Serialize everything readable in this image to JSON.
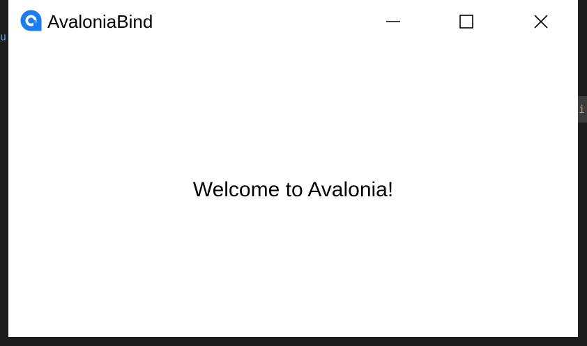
{
  "background": {
    "left_glyph": "u",
    "right_glyph": "i"
  },
  "window": {
    "title": "AvaloniaBind",
    "icon": "avalonia-logo-icon",
    "accent_color": "#1a7cf5",
    "controls": {
      "minimize": "minimize-icon",
      "maximize": "maximize-icon",
      "close": "close-icon"
    }
  },
  "content": {
    "message": "Welcome to Avalonia!"
  }
}
